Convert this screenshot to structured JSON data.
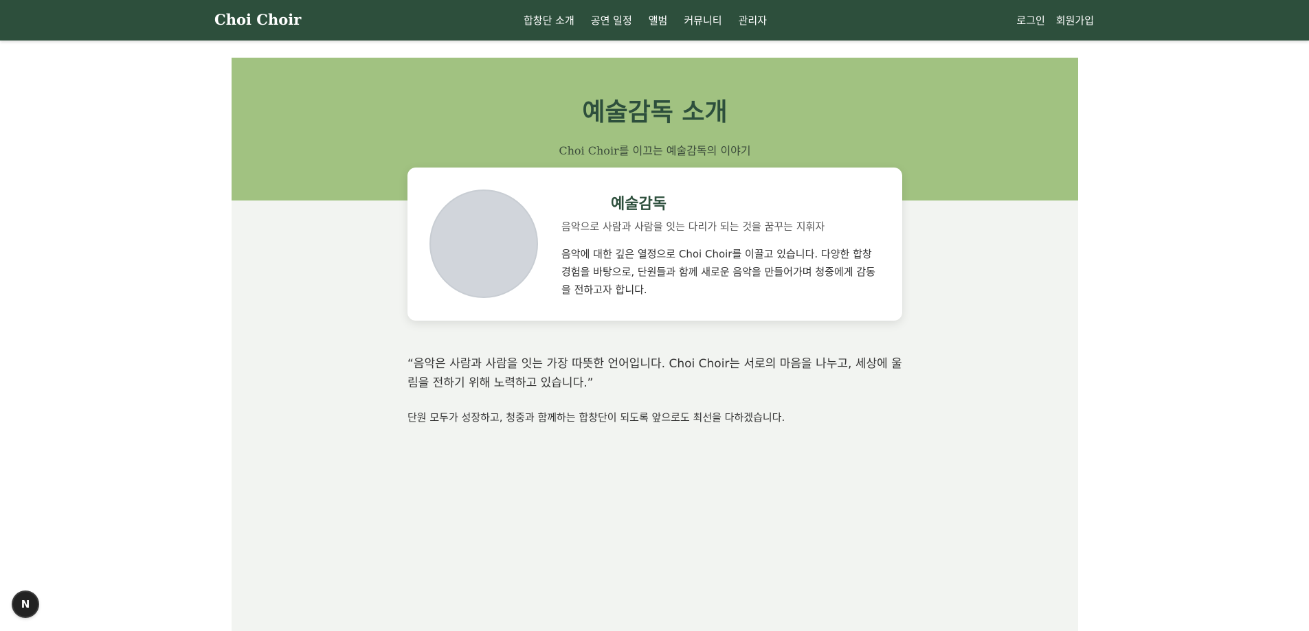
{
  "header": {
    "brand": "Choi Choir",
    "nav": [
      {
        "label": "합창단 소개"
      },
      {
        "label": "공연 일정"
      },
      {
        "label": "앨범"
      },
      {
        "label": "커뮤니티"
      },
      {
        "label": "관리자"
      }
    ],
    "login_label": "로그인",
    "signup_label": "회원가입"
  },
  "hero": {
    "title": "예술감독 소개",
    "subtitle": "Choi Choir를 이끄는 예술감독의 이야기"
  },
  "profile": {
    "title": "예술감독",
    "tagline": "음악으로 사람과 사람을 잇는 다리가 되는 것을 꿈꾸는 지휘자",
    "bio": "음악에 대한 깊은 열정으로 Choi Choir를 이끌고 있습니다. 다양한 합창 경험을 바탕으로, 단원들과 함께 새로운 음악을 만들어가며 청중에게 감동을 전하고자 합니다."
  },
  "message": {
    "quote": "“음악은 사람과 사람을 잇는 가장 따뜻한 언어입니다. Choi Choir는 서로의 마음을 나누고, 세상에 울림을 전하기 위해 노력하고 있습니다.”",
    "closing": "단원 모두가 성장하고, 청중과 함께하는 합창단이 되도록 앞으로도 최선을 다하겠습니다."
  },
  "floating_button": {
    "label": "N",
    "icon": "nextjs-logo-icon"
  },
  "colors": {
    "nav_bg": "#2d4f3c",
    "hero_bg": "#a1c281",
    "page_bg": "#f2f4f1",
    "title_green": "#2d4f3c",
    "avatar_placeholder": "#d1d5db"
  }
}
